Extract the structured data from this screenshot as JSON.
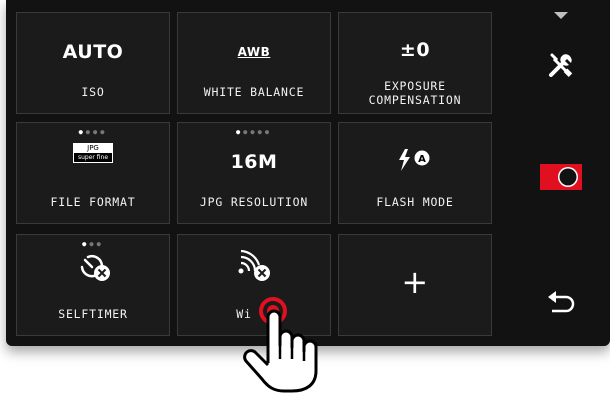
{
  "tiles": {
    "iso": {
      "value": "AUTO",
      "label": "ISO"
    },
    "white_balance": {
      "value": "AWB",
      "label": "WHITE BALANCE"
    },
    "exposure": {
      "value": "±0",
      "label_line1": "EXPOSURE",
      "label_line2": "COMPENSATION"
    },
    "file_format": {
      "badge_top": "JPG",
      "badge_bottom": "super fine",
      "label": "FILE FORMAT"
    },
    "jpg_resolution": {
      "value": "16M",
      "label": "JPG RESOLUTION"
    },
    "flash_mode": {
      "label": "FLASH MODE"
    },
    "selftimer": {
      "label": "SELFTIMER"
    },
    "wifi": {
      "label": "Wi"
    },
    "add": {
      "value": "+"
    }
  },
  "sidebar": {
    "icons": [
      "tools-icon",
      "camera-mode-icon",
      "back-arrow-icon"
    ],
    "accent_color": "#e01020"
  },
  "touch_color": "#e01020"
}
